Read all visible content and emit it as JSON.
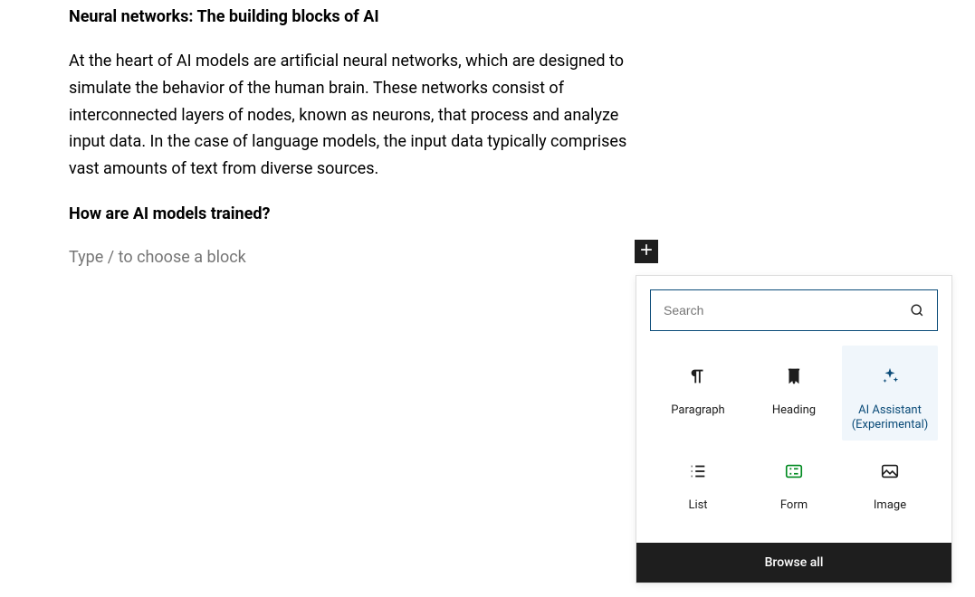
{
  "content": {
    "heading1": "Neural networks: The building blocks of AI",
    "paragraph1": "At the heart of AI models are artificial neural networks, which are designed to simulate the behavior of the human brain. These networks consist of interconnected layers of nodes, known as neurons, that process and analyze input data. In the case of language models, the input data typically comprises vast amounts of text from diverse sources.",
    "heading2": "How are AI models trained?",
    "new_block_placeholder": "Type / to choose a block"
  },
  "inserter": {
    "search_placeholder": "Search",
    "blocks": {
      "paragraph": "Paragraph",
      "heading": "Heading",
      "ai_assistant": "AI Assistant\n(Experimental)",
      "list": "List",
      "form": "Form",
      "image": "Image"
    },
    "browse_all": "Browse all"
  }
}
